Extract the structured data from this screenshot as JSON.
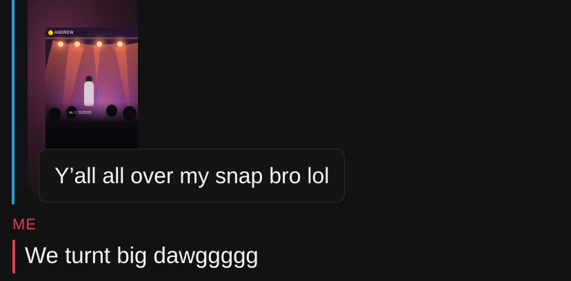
{
  "thread": {
    "other_accent_color": "#2e9bdb",
    "me_accent_color": "#e0404d",
    "background_color": "#121212"
  },
  "media": {
    "username": "ANDREW",
    "caption": "on ⓘ 11/22/23",
    "user_icon": "snap-ghost-icon"
  },
  "messages": {
    "incoming_reply": "Y’all all over my snap bro lol",
    "me_label": "ME",
    "me_text": "We turnt big dawggggg"
  }
}
